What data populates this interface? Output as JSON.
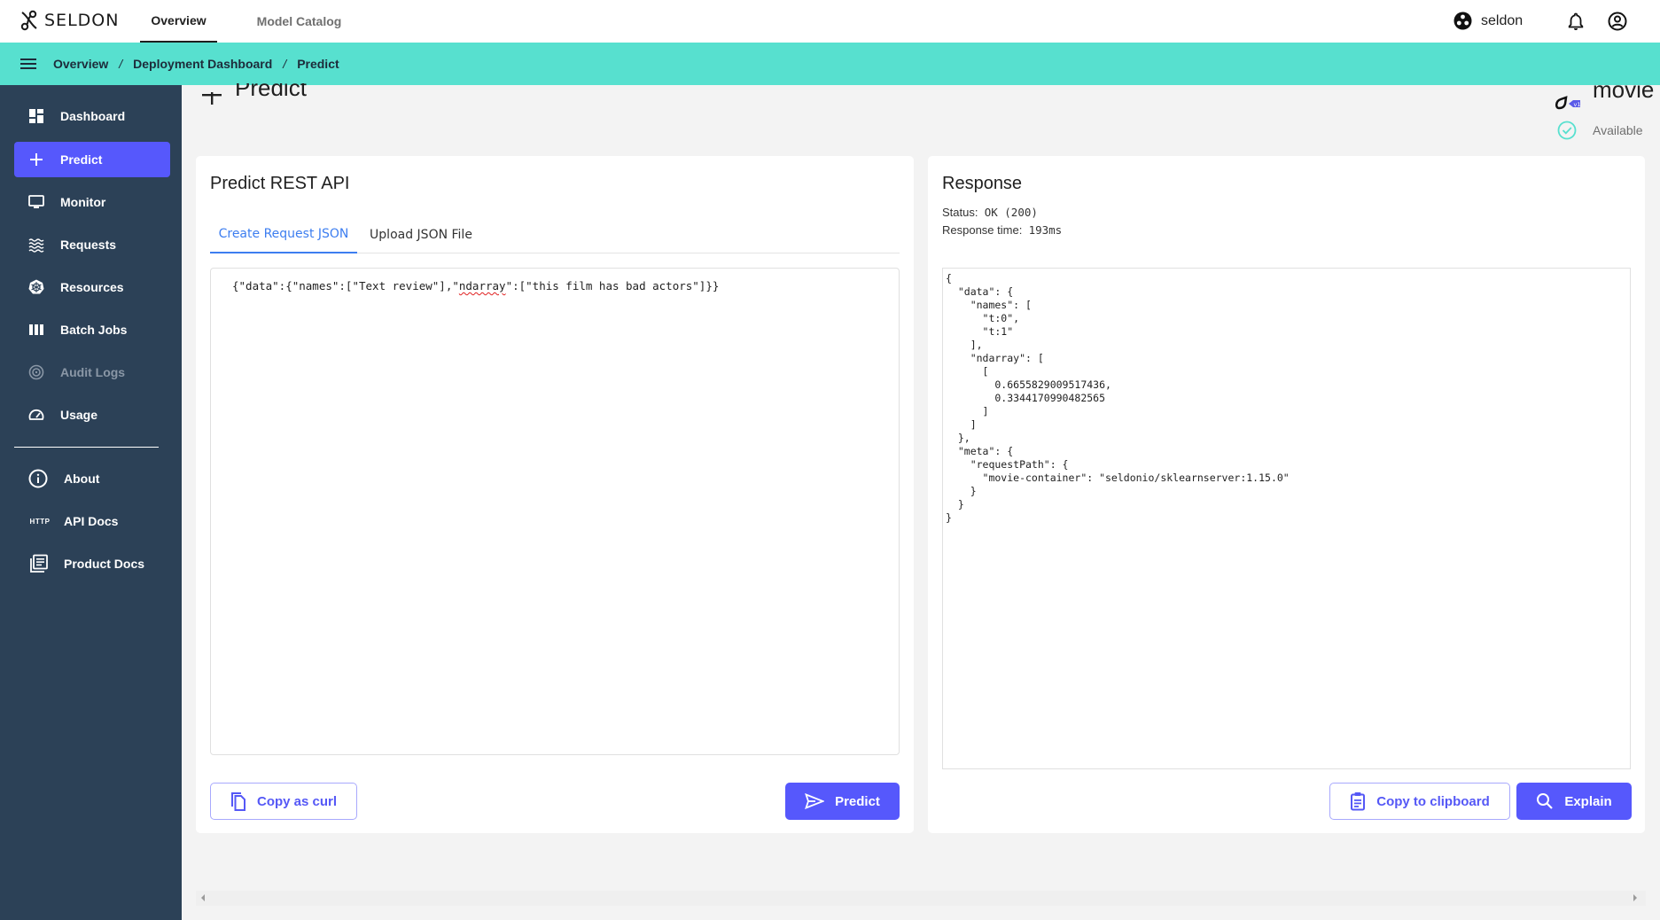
{
  "app": {
    "logo_text": "SELDON",
    "top_tabs": [
      {
        "label": "Overview",
        "active": true
      },
      {
        "label": "Model Catalog",
        "active": false
      }
    ],
    "org_name": "seldon",
    "icons": {
      "org": "org-icon",
      "notifications": "bell-icon",
      "account": "account-circle-icon"
    }
  },
  "breadcrumb": {
    "items": [
      "Overview",
      "Deployment Dashboard",
      "Predict"
    ],
    "separator": "/"
  },
  "sidebar": {
    "items": [
      {
        "label": "Dashboard",
        "icon": "dashboard-icon",
        "active": false,
        "disabled": false
      },
      {
        "label": "Predict",
        "icon": "plus-icon",
        "active": true,
        "disabled": false
      },
      {
        "label": "Monitor",
        "icon": "monitor-icon",
        "active": false,
        "disabled": false
      },
      {
        "label": "Requests",
        "icon": "waves-icon",
        "active": false,
        "disabled": false
      },
      {
        "label": "Resources",
        "icon": "kubernetes-icon",
        "active": false,
        "disabled": false
      },
      {
        "label": "Batch Jobs",
        "icon": "columns-icon",
        "active": false,
        "disabled": false
      },
      {
        "label": "Audit Logs",
        "icon": "audit-icon",
        "active": false,
        "disabled": true
      },
      {
        "label": "Usage",
        "icon": "gauge-icon",
        "active": false,
        "disabled": false
      }
    ],
    "secondary_items": [
      {
        "label": "About",
        "icon": "info-icon"
      },
      {
        "label": "API Docs",
        "icon": "http-icon",
        "icon_text": "HTTP"
      },
      {
        "label": "Product Docs",
        "icon": "docs-icon"
      }
    ]
  },
  "page": {
    "title": "Predict",
    "model": {
      "name": "movie",
      "version_badge": "v1",
      "status": "Available"
    }
  },
  "request_card": {
    "title": "Predict REST API",
    "tabs": [
      {
        "label": "Create Request JSON",
        "active": true
      },
      {
        "label": "Upload JSON File",
        "active": false
      }
    ],
    "editor": {
      "prefix": "{\"data\":{\"names\":[\"Text review\"],\"",
      "misspelled": "ndarray",
      "suffix": "\":[\"this film has bad actors\"]}}"
    },
    "buttons": {
      "copy_curl": "Copy as curl",
      "predict": "Predict"
    }
  },
  "response_card": {
    "title": "Response",
    "status_label": "Status:",
    "status_value": "OK (200)",
    "time_label": "Response time:",
    "time_value": "193ms",
    "body": "{\n  \"data\": {\n    \"names\": [\n      \"t:0\",\n      \"t:1\"\n    ],\n    \"ndarray\": [\n      [\n        0.6655829009517436,\n        0.3344170990482565\n      ]\n    ]\n  },\n  \"meta\": {\n    \"requestPath\": {\n      \"movie-container\": \"seldonio/sklearnserver:1.15.0\"\n    }\n  }\n}",
    "buttons": {
      "copy_clipboard": "Copy to clipboard",
      "explain": "Explain"
    }
  },
  "colors": {
    "accent": "#5658fc",
    "teal": "#57e0cf",
    "sidebar_bg": "#2c4157",
    "tab_active": "#3d7ef0",
    "status_ok": "#57e0cf"
  }
}
